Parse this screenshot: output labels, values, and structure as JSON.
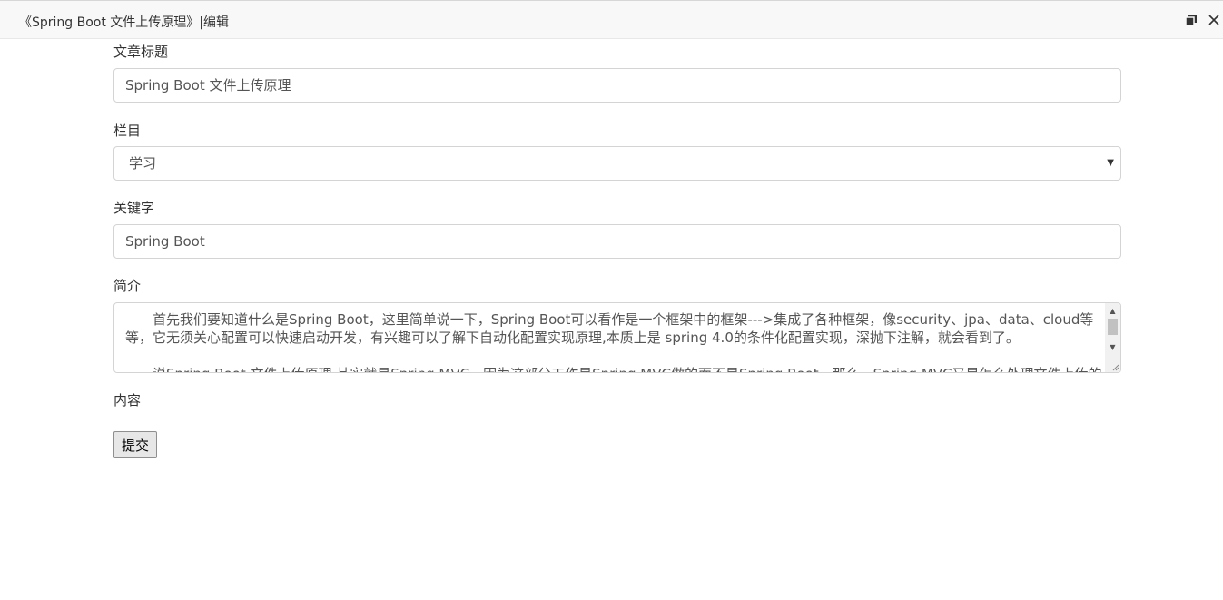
{
  "window": {
    "title": "《Spring Boot 文件上传原理》|编辑",
    "maximize_icon": "restore-icon",
    "close_icon": "close-icon"
  },
  "form": {
    "title_label": "文章标题",
    "title_value": "Spring Boot 文件上传原理",
    "category_label": "栏目",
    "category_value": "学习",
    "keywords_label": "关键字",
    "keywords_value": "Spring Boot",
    "intro_label": "简介",
    "intro_paragraph_1": "首先我们要知道什么是Spring Boot，这里简单说一下，Spring Boot可以看作是一个框架中的框架--->集成了各种框架，像security、jpa、data、cloud等等，它无须关心配置可以快速启动开发，有兴趣可以了解下自动化配置实现原理,本质上是 spring 4.0的条件化配置实现，深抛下注解，就会看到了。",
    "intro_paragraph_2": "说Spring Boot 文件上传原理 其实就是Spring MVC，因为这部分工作是Spring MVC做的而不是Spring Boot，那么，Spring MVC又是怎么处理文件上传的呢？",
    "content_label": "内容",
    "submit_label": "提交"
  }
}
